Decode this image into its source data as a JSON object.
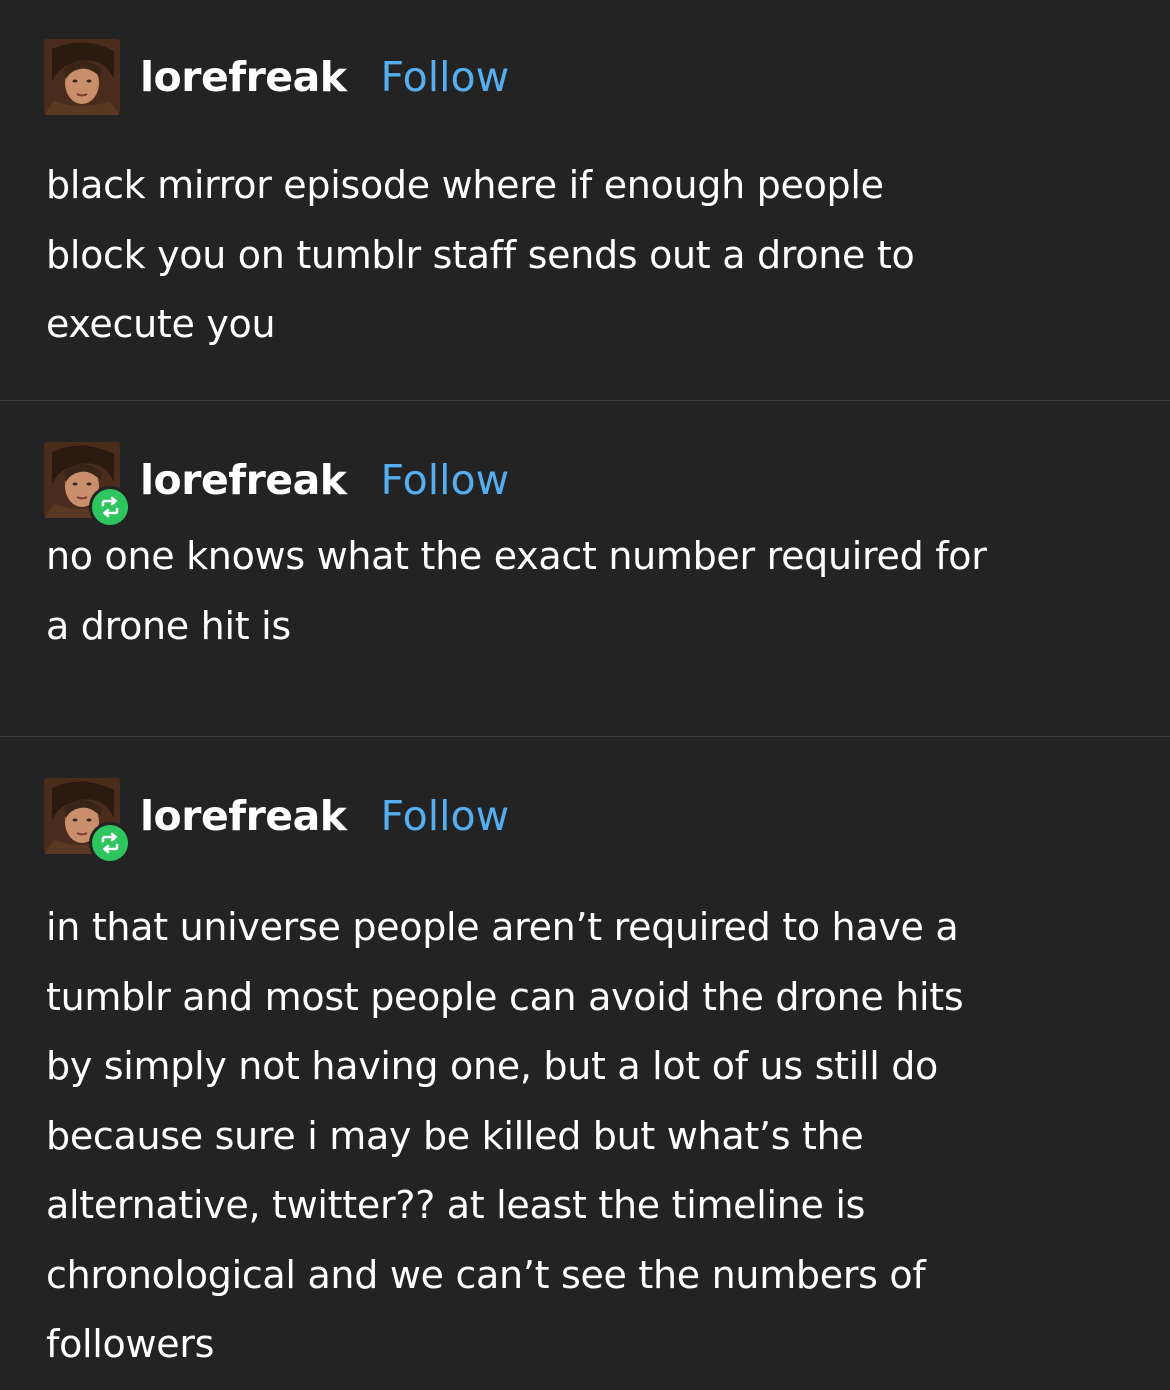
{
  "colors": {
    "background": "#232323",
    "text": "#ffffff",
    "follow_link": "#56aef0",
    "reblog_badge": "#2ec45e",
    "divider": "#3c3c3c"
  },
  "posts": [
    {
      "username": "lorefreak",
      "follow_label": "Follow",
      "avatar_icon": "user-avatar-icon",
      "reblog": false,
      "lines": [
        "black mirror episode where if enough people",
        "block you on tumblr staff sends out a drone to",
        "execute you"
      ]
    },
    {
      "username": "lorefreak",
      "follow_label": "Follow",
      "avatar_icon": "user-avatar-icon",
      "reblog": true,
      "reblog_icon": "reblog-icon",
      "lines": [
        "no one knows what the exact number required for",
        "a drone hit is"
      ]
    },
    {
      "username": "lorefreak",
      "follow_label": "Follow",
      "avatar_icon": "user-avatar-icon",
      "reblog": true,
      "reblog_icon": "reblog-icon",
      "lines": [
        "in that universe people aren’t required to have a",
        "tumblr and most people can avoid the drone hits",
        "by simply not having one, but a lot of us still do",
        "because sure i may be killed but what’s the",
        "alternative, twitter?? at least the timeline is",
        "chronological and we can’t see the numbers of",
        "followers"
      ]
    }
  ]
}
